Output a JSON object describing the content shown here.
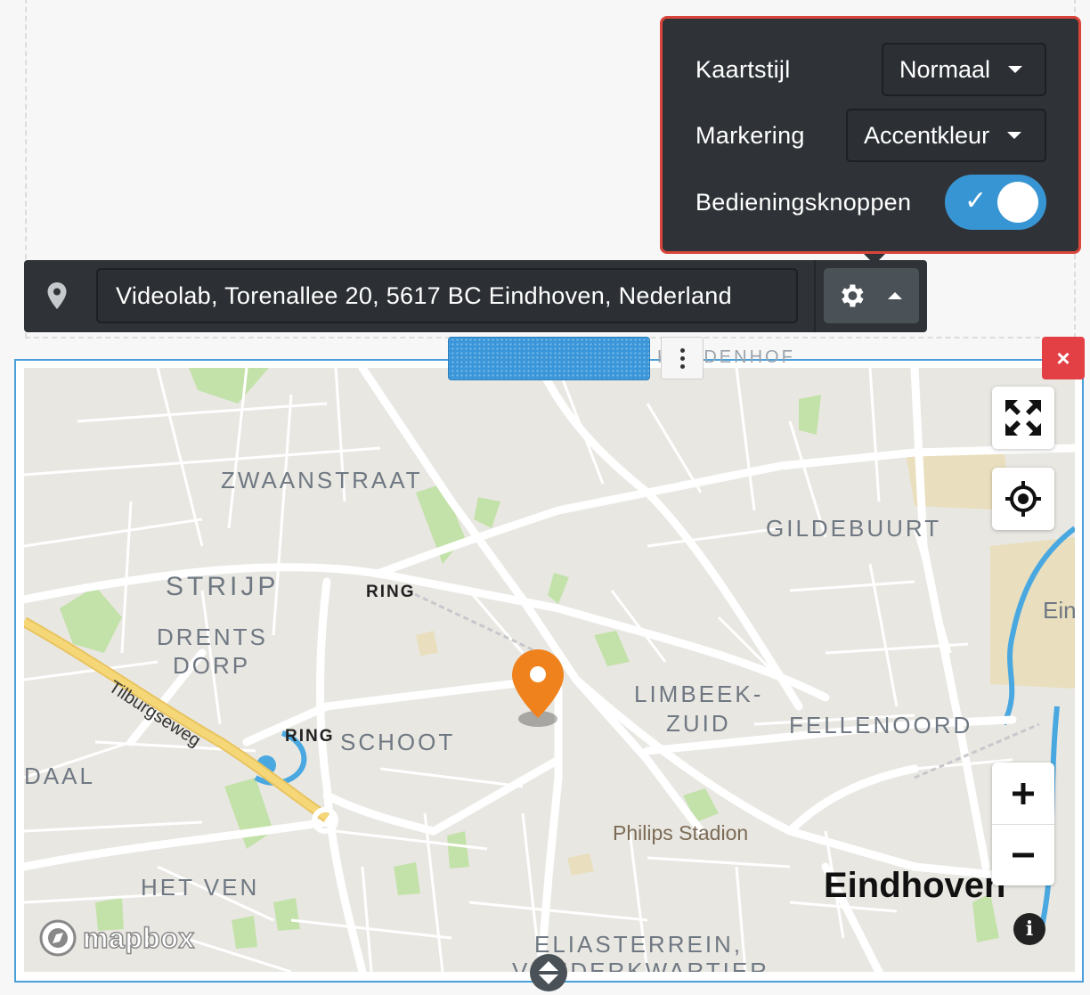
{
  "settings": {
    "map_style_label": "Kaartstijl",
    "map_style_value": "Normaal",
    "marker_label": "Markering",
    "marker_value": "Accentkleur",
    "controls_label": "Bedieningsknoppen",
    "controls_enabled": true,
    "toggle_check": "✓"
  },
  "address_bar": {
    "value": "Videolab, Torenallee 20, 5617 BC Eindhoven, Nederland"
  },
  "block_toolbar": {
    "close_symbol": "×"
  },
  "map": {
    "places": {
      "zwaanstraat": "ZWAANSTRAAT",
      "gildebuurt": "GILDEBUURT",
      "strijp": "STRIJP",
      "drents": "DRENTS",
      "dorp": "DORP",
      "limbeek": "LIMBEEK-",
      "zuid": "ZUID",
      "fellenoord": "FELLENOORD",
      "schoot": "SCHOOT",
      "daal": "DAAL",
      "het_ven": "HET VEN",
      "eliasterrein": "ELIASTERREIN,",
      "vonderkwartier": "VONDERKWARTIER",
      "top_partial": "KOUDENHOF",
      "ein_partial": "Ein"
    },
    "ring_1": "RING",
    "ring_2": "RING",
    "road": "Tilburgseweg",
    "poi": "Philips Stadion",
    "city": "Eindhoven",
    "attribution_logo": "mapbox",
    "info_label": "i",
    "zoom_in": "+",
    "zoom_out": "−",
    "colors": {
      "marker": "#f0821e",
      "accent": "#3895d3",
      "highlight_border": "#d9453b",
      "park": "#bfe0a6",
      "water": "#4aa8e0"
    }
  }
}
